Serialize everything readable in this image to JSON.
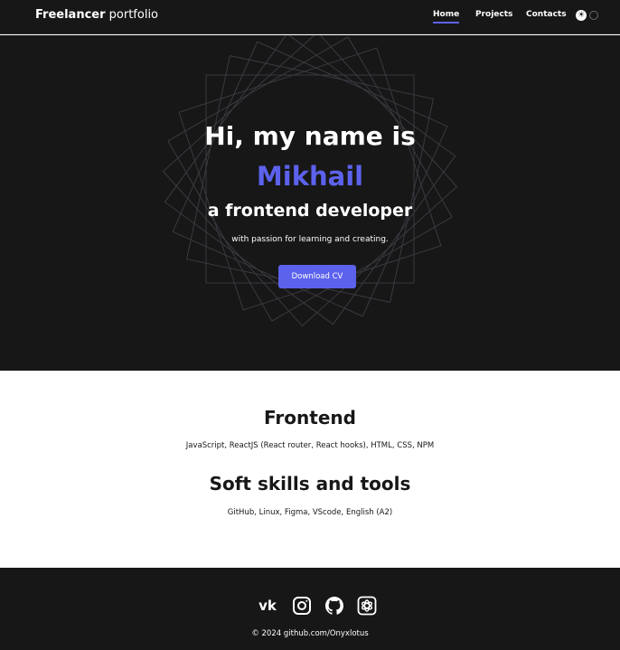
{
  "header": {
    "logo_bold": "Freelancer",
    "logo_light": "portfolio",
    "nav": [
      "Home",
      "Projects",
      "Contacts"
    ],
    "active": "Home"
  },
  "hero": {
    "title": "Hi, my name is",
    "name": "Mikhail",
    "role": "a frontend developer",
    "tagline": "with passion for learning and creating.",
    "button": "Download CV"
  },
  "skills": [
    {
      "heading": "Frontend",
      "items": "JavaScript, ReactJS (React router, React hooks), HTML, CSS, NPM"
    },
    {
      "heading": "Soft skills and tools",
      "items": "GitHub, Linux, Figma, VScode, English (A2)"
    }
  ],
  "footer": {
    "socials": [
      "vk-icon",
      "instagram-icon",
      "github-icon",
      "openai-icon"
    ],
    "copyright": "© 2024 github.com/Onyxlotus"
  },
  "colors": {
    "dark": "#171718",
    "accent": "#5c62ec",
    "light": "#ffffff"
  }
}
